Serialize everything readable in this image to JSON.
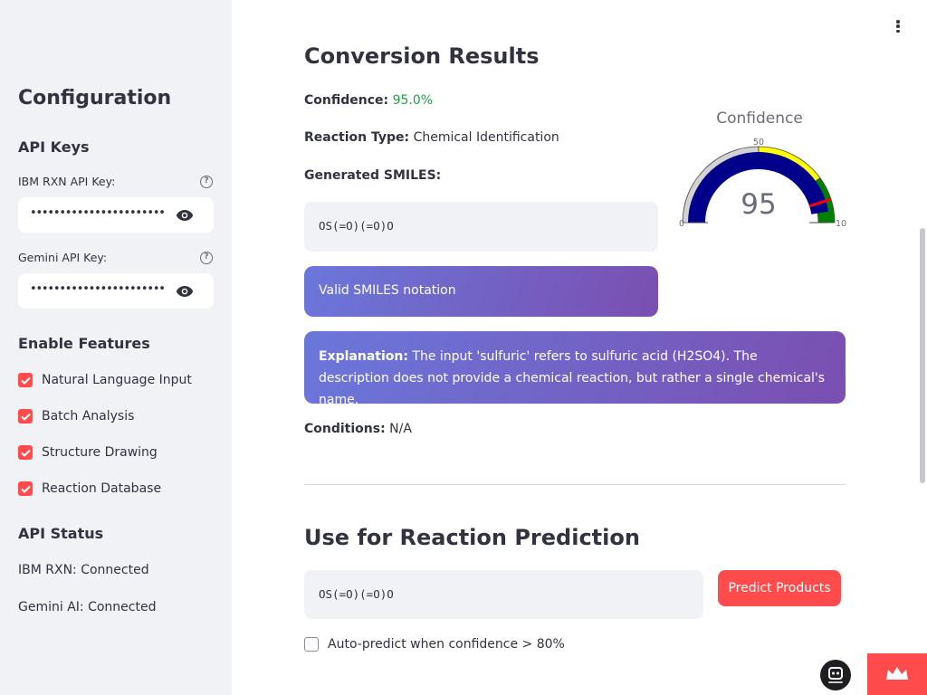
{
  "sidebar": {
    "title": "Configuration",
    "api_keys_heading": "API Keys",
    "ibm_key_label": "IBM RXN API Key:",
    "ibm_key_value": "••••••••••••••••••••••••••••••••",
    "gemini_key_label": "Gemini API Key:",
    "gemini_key_value": "••••••••••••••••••••••••••••••••",
    "help_glyph": "?",
    "features_heading": "Enable Features",
    "features": [
      {
        "label": "Natural Language Input",
        "checked": true
      },
      {
        "label": "Batch Analysis",
        "checked": true
      },
      {
        "label": "Structure Drawing",
        "checked": true
      },
      {
        "label": "Reaction Database",
        "checked": true
      }
    ],
    "status_heading": "API Status",
    "status_items": [
      "IBM RXN: Connected",
      "Gemini AI: Connected"
    ]
  },
  "results": {
    "title": "Conversion Results",
    "confidence_label": "Confidence:",
    "confidence_value": "95.0%",
    "reaction_type_label": "Reaction Type:",
    "reaction_type_value": "Chemical Identification",
    "smiles_label": "Generated SMILES:",
    "smiles_value": "OS(=O)(=O)O",
    "valid_message": "Valid SMILES notation",
    "explanation_label": "Explanation:",
    "explanation_text": "The input 'sulfuric' refers to sulfuric acid (H2SO4). The description does not provide a chemical reaction, but rather a single chemical's name.",
    "conditions_label": "Conditions:",
    "conditions_value": "N/A"
  },
  "gauge": {
    "title": "Confidence",
    "value": 95,
    "value_text": "95",
    "min_label": "0",
    "mid_label": "50",
    "max_label": "10",
    "range": [
      0,
      100
    ],
    "threshold": 90,
    "colors": {
      "low": "#d3d3d3",
      "mid": "#ffff00",
      "high": "#008000",
      "bar": "#00008b",
      "threshold": "#ff0000"
    }
  },
  "prediction": {
    "title": "Use for Reaction Prediction",
    "input_value": "OS(=O)(=O)O",
    "predict_label": "Predict Products",
    "auto_predict_label": "Auto-predict when confidence > 80%",
    "auto_predict_checked": false
  },
  "colors": {
    "accent": "#ff4b4b",
    "sidebar_bg": "#f0f2f6",
    "success": "#21a045"
  }
}
